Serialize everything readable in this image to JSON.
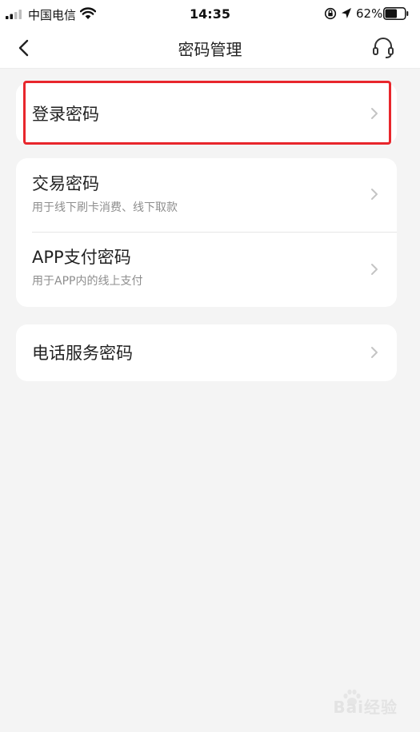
{
  "status_bar": {
    "carrier": "中国电信",
    "time": "14:35",
    "battery_percent": "62%",
    "battery_level": 0.62
  },
  "nav": {
    "title": "密码管理",
    "back_icon": "chevron-left-icon",
    "service_icon": "headset-icon"
  },
  "groups": [
    {
      "items": [
        {
          "title": "登录密码",
          "subtitle": ""
        }
      ]
    },
    {
      "items": [
        {
          "title": "交易密码",
          "subtitle": "用于线下刷卡消费、线下取款"
        },
        {
          "title": "APP支付密码",
          "subtitle": "用于APP内的线上支付"
        }
      ]
    },
    {
      "items": [
        {
          "title": "电话服务密码",
          "subtitle": ""
        }
      ]
    }
  ],
  "highlight": {
    "color": "#e8262c",
    "target": "登录密码"
  },
  "colors": {
    "background": "#f4f4f4",
    "card": "#ffffff",
    "title_text": "#222222",
    "subtitle_text": "#8e8e8e",
    "chevron": "#c4c4c4"
  },
  "watermark": {
    "text": "Bai经验"
  }
}
